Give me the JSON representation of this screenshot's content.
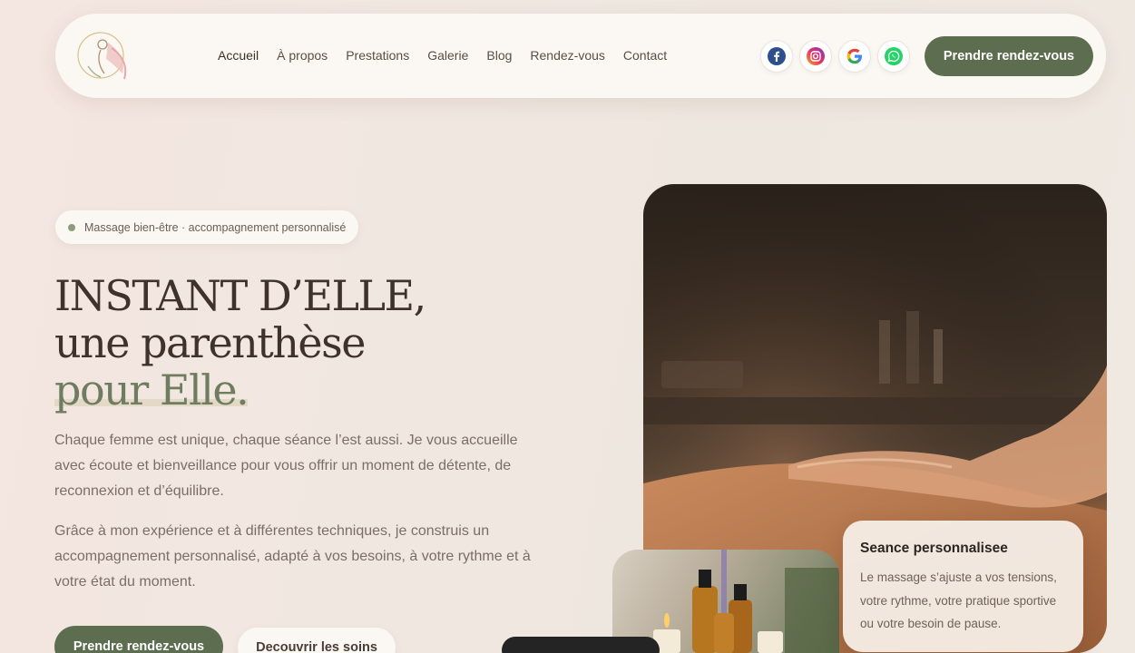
{
  "nav": {
    "menu": [
      "Accueil",
      "À propos",
      "Prestations",
      "Galerie",
      "Blog",
      "Rendez-vous",
      "Contact"
    ],
    "socials": [
      "facebook-icon",
      "instagram-icon",
      "google-icon",
      "whatsapp-icon"
    ],
    "cta": "Prendre rendez-vous"
  },
  "hero": {
    "badge": "Massage bien-être · accompagnement personnalisé",
    "title_line1": "INSTANT D’ELLE,",
    "title_line2": "une parenthèse",
    "title_line3": "pour Elle.",
    "paragraph1": "Chaque femme est unique, chaque séance l’est aussi. Je vous accueille avec écoute et bienveillance pour vous offrir un moment de détente, de reconnexion et d’équilibre.",
    "paragraph2": "Grâce à mon expérience et à différentes techniques, je construis un accompagnement personnalisé, adapté à vos besoins, à votre rythme et à votre état du moment.",
    "btn_primary": "Prendre rendez-vous",
    "btn_secondary": "Decouvrir les soins"
  },
  "card": {
    "title": "Seance personnalisee",
    "text": "Le massage s’ajuste a vos tensions, votre rythme, votre pratique sportive ou votre besoin de pause."
  },
  "colors": {
    "accent": "#5d6e50",
    "title": "#3f322b",
    "highlight": "#6e7d5f"
  }
}
